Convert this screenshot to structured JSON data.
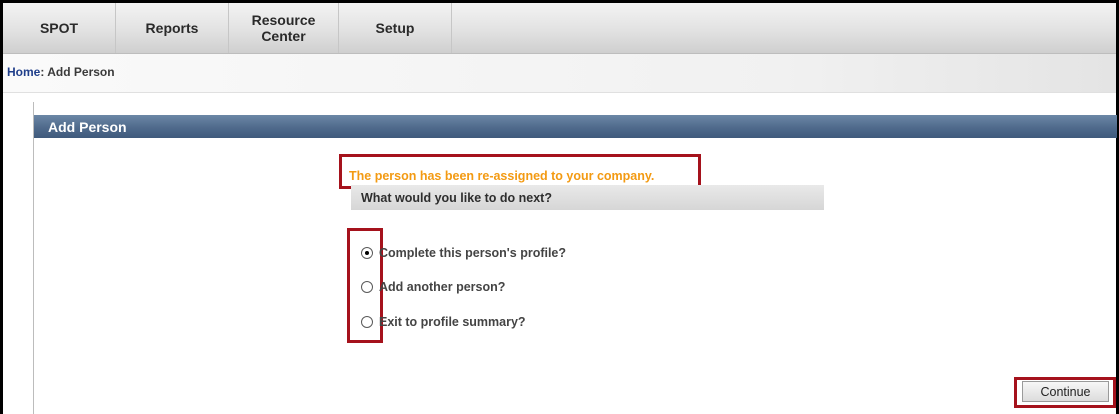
{
  "nav": {
    "tabs": [
      {
        "label": "SPOT"
      },
      {
        "label": "Reports"
      },
      {
        "label": "Resource\nCenter"
      },
      {
        "label": "Setup"
      }
    ]
  },
  "breadcrumb": {
    "home": "Home",
    "separator": ": ",
    "current": "Add Person"
  },
  "panel": {
    "title": "Add Person",
    "message": "The person has been re-assigned to your company.",
    "next_prompt": "What would you like to do next?",
    "options": [
      {
        "label": "Complete this person's profile?",
        "selected": true
      },
      {
        "label": "Add another person?",
        "selected": false
      },
      {
        "label": "Exit to profile summary?",
        "selected": false
      }
    ],
    "continue_label": "Continue"
  },
  "colors": {
    "highlight_border": "#a5121c",
    "message_text": "#f39a12",
    "panel_header": "#4f6a8c",
    "home_link": "#1f3e8a"
  }
}
